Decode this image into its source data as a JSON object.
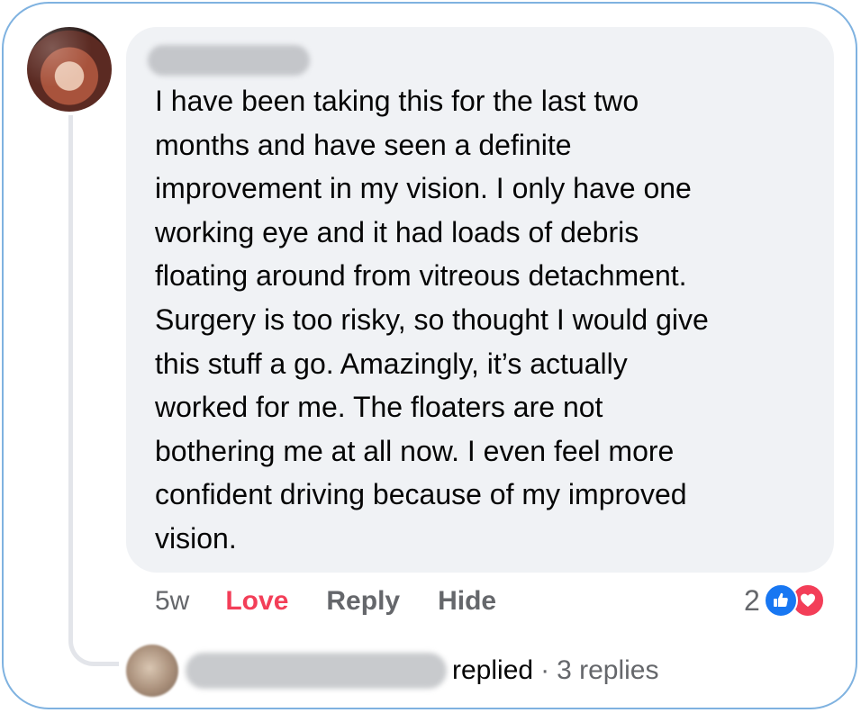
{
  "comment": {
    "text": "I have been taking this for the last two\nmonths and have seen a definite\nimprovement in my vision. I only have one\nworking eye and it had loads of debris\nfloating around from vitreous detachment.\nSurgery is too risky, so thought I would give\nthis stuff a go. Amazingly, it’s actually\nworked for me. The floaters are not\nbothering me at all now. I even feel more\nconfident driving because of my improved\nvision.",
    "time": "5w",
    "actions": {
      "love": "Love",
      "reply": "Reply",
      "hide": "Hide"
    },
    "reactions": {
      "count": "2",
      "types": [
        "like",
        "love"
      ]
    }
  },
  "reply_summary": {
    "replied_label": "replied",
    "separator": "·",
    "count_label": "3 replies"
  },
  "colors": {
    "card_border": "#7fb2e0",
    "bubble": "#f0f2f5",
    "love_accent": "#f33e58",
    "like_blue": "#1877f2",
    "muted_text": "#65676b"
  },
  "icons": {
    "like": "thumbs-up-icon",
    "love": "heart-icon"
  }
}
